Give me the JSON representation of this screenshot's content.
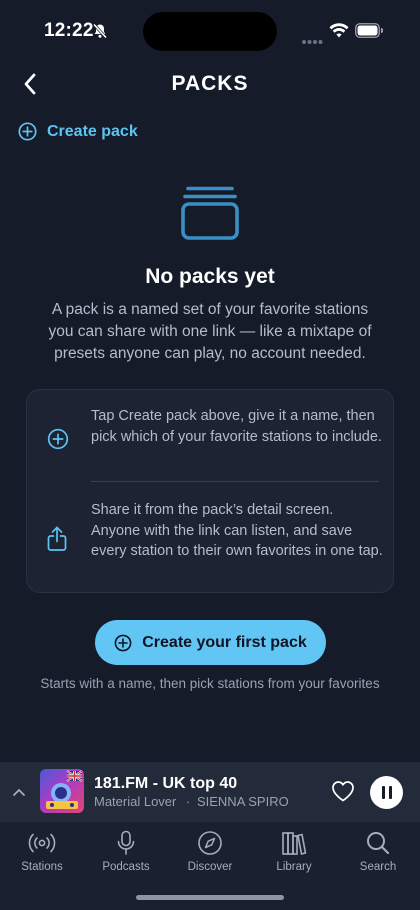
{
  "status_bar": {
    "time": "12:22"
  },
  "header": {
    "title": "PACKS"
  },
  "create_link": {
    "label": "Create pack"
  },
  "empty_state": {
    "title": "No packs yet",
    "description": "A pack is a named set of your favorite stations you can share with one link — like a mixtape of presets anyone can play, no account needed."
  },
  "steps": [
    {
      "icon": "plus-circle-icon",
      "text": "Tap Create pack above, give it a name, then pick which of your favorite stations to include."
    },
    {
      "icon": "share-icon",
      "text": "Share it from the pack’s detail screen. Anyone with the link can listen, and save every station to their own favorites in one tap."
    }
  ],
  "cta": {
    "label": "Create your first pack",
    "hint": "Starts with a name, then pick stations from your favorites"
  },
  "now_playing": {
    "station": "181.FM - UK top 40",
    "track": "Material Lover",
    "artist": "SIENNA SPIRO",
    "separator": "·",
    "favorited": false,
    "state": "playing"
  },
  "tabs": [
    {
      "label": "Stations",
      "icon": "radio-waves-icon"
    },
    {
      "label": "Podcasts",
      "icon": "microphone-icon"
    },
    {
      "label": "Discover",
      "icon": "compass-icon"
    },
    {
      "label": "Library",
      "icon": "library-icon"
    },
    {
      "label": "Search",
      "icon": "search-icon"
    }
  ],
  "colors": {
    "background": "#151b29",
    "accent": "#5cc4f2",
    "card": "#1d2332",
    "button": "#62c6f5"
  }
}
